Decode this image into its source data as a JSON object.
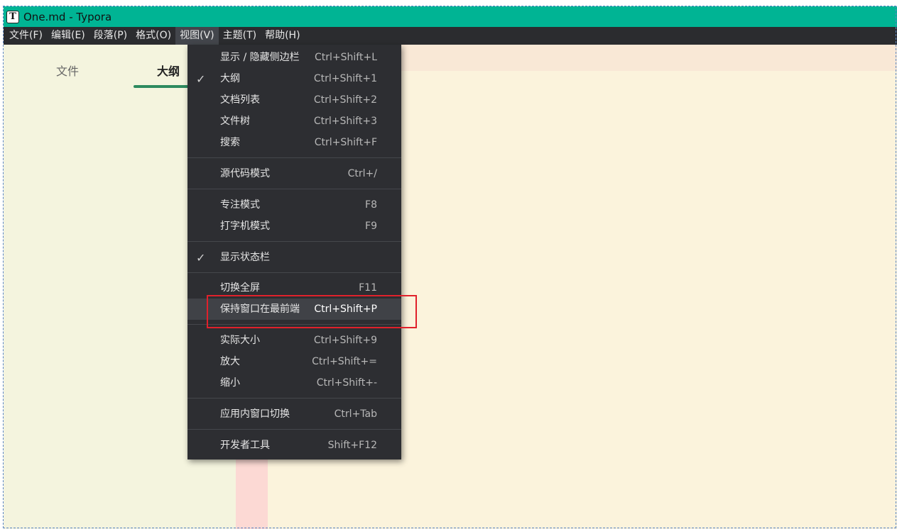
{
  "window": {
    "title": "One.md - Typora",
    "app_icon_letter": "T"
  },
  "menubar": {
    "items": [
      "文件(F)",
      "编辑(E)",
      "段落(P)",
      "格式(O)",
      "视图(V)",
      "主题(T)",
      "帮助(H)"
    ],
    "active": "视图(V)"
  },
  "sidebar": {
    "tabs": [
      "文件",
      "大纲"
    ],
    "active_tab": "大纲"
  },
  "view_menu": {
    "items": [
      {
        "label": "显示 / 隐藏侧边栏",
        "accel": "Ctrl+Shift+L",
        "checked": false
      },
      {
        "label": "大纲",
        "accel": "Ctrl+Shift+1",
        "checked": true
      },
      {
        "label": "文档列表",
        "accel": "Ctrl+Shift+2",
        "checked": false
      },
      {
        "label": "文件树",
        "accel": "Ctrl+Shift+3",
        "checked": false
      },
      {
        "label": "搜索",
        "accel": "Ctrl+Shift+F",
        "checked": false
      },
      {
        "label": "源代码模式",
        "accel": "Ctrl+/",
        "checked": false
      },
      {
        "label": "专注模式",
        "accel": "F8",
        "checked": false
      },
      {
        "label": "打字机模式",
        "accel": "F9",
        "checked": false
      },
      {
        "label": "显示状态栏",
        "accel": "",
        "checked": true
      },
      {
        "label": "切换全屏",
        "accel": "F11",
        "checked": false
      },
      {
        "label": "保持窗口在最前端",
        "accel": "Ctrl+Shift+P",
        "checked": false,
        "hovered": true
      },
      {
        "label": "实际大小",
        "accel": "Ctrl+Shift+9",
        "checked": false
      },
      {
        "label": "放大",
        "accel": "Ctrl+Shift+=",
        "checked": false
      },
      {
        "label": "缩小",
        "accel": "Ctrl+Shift+-",
        "checked": false
      },
      {
        "label": "应用内窗口切换",
        "accel": "Ctrl+Tab",
        "checked": false
      },
      {
        "label": "开发者工具",
        "accel": "Shift+F12",
        "checked": false
      }
    ],
    "check_glyph": "✓"
  },
  "colors": {
    "titlebar": "#00b494",
    "menubar": "#2b2c2f",
    "menu_bg": "#2d2e32",
    "sidebar_bg": "#f4f4de",
    "editor_bg": "#fbf3dc",
    "accent_underline": "#2d8a5f",
    "annotation_box": "#e0212b"
  }
}
